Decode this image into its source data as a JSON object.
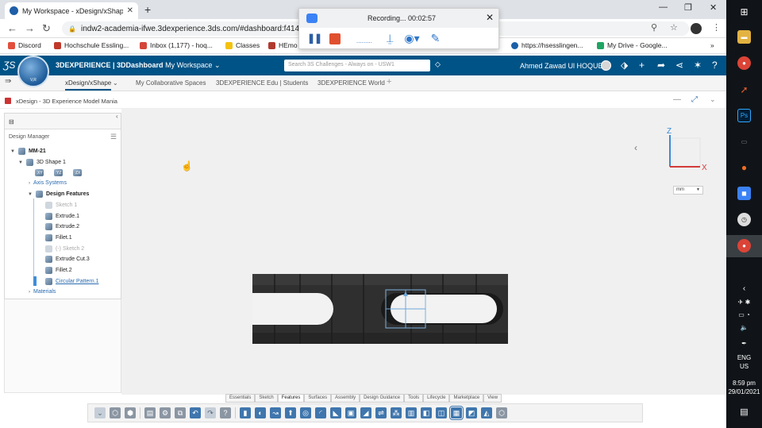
{
  "browser": {
    "tab_title": "My Workspace - xDesign/xShape",
    "url": "indw2-academia-ifwe.3dexperience.3ds.com/#dashboard:f4143c",
    "bookmarks": [
      "Discord",
      "Hochschule Essling...",
      "Inbox (1,177) - hoq...",
      "Classes",
      "HEmo",
      "https://hsesslingen...",
      "My Drive - Google..."
    ]
  },
  "recorder": {
    "status": "Recording... 00:02:57"
  },
  "platform": {
    "brand_prefix": "3DEXPERIENCE | 3DDashboard",
    "workspace": "My Workspace",
    "search_placeholder": "Search 3S Challenges - Always on - USW1",
    "user": "Ahmed Zawad Ul HOQUE",
    "compass_version": "V,R"
  },
  "app_tabs": [
    "xDesign/xShape",
    "My Collaborative Spaces",
    "3DEXPERIENCE Edu | Students",
    "3DEXPERIENCE World"
  ],
  "app_title": "xDesign - 3D Experience Model Mania",
  "tree": {
    "title": "Design Manager",
    "root": "MM-21",
    "shape": "3D Shape 1",
    "planes": [
      "XY",
      "YZ",
      "ZX"
    ],
    "axis_systems": "Axis Systems",
    "design_features": "Design Features",
    "features": [
      {
        "label": "Sketch 1",
        "state": "dim"
      },
      {
        "label": "Extrude.1",
        "state": "normal"
      },
      {
        "label": "Extrude.2",
        "state": "normal"
      },
      {
        "label": "Fillet.1",
        "state": "normal"
      },
      {
        "label": "(-)     Sketch 2",
        "state": "dim"
      },
      {
        "label": "Extrude Cut.3",
        "state": "normal"
      },
      {
        "label": "Fillet.2",
        "state": "normal"
      },
      {
        "label": "Circular Pattern.1",
        "state": "link"
      }
    ],
    "materials": "Materials"
  },
  "viewport": {
    "unit": "mm",
    "axis_x": "X",
    "axis_z": "Z"
  },
  "ribbon_tabs": [
    "Essentials",
    "Sketch",
    "Features",
    "Surfaces",
    "Assembly",
    "Design Guidance",
    "Tools",
    "Lifecycle",
    "Marketplace",
    "View"
  ],
  "ribbon_active": "Features",
  "taskbar": {
    "lang": "ENG",
    "region": "US",
    "time": "8:59 pm",
    "date": "29/01/2021"
  }
}
